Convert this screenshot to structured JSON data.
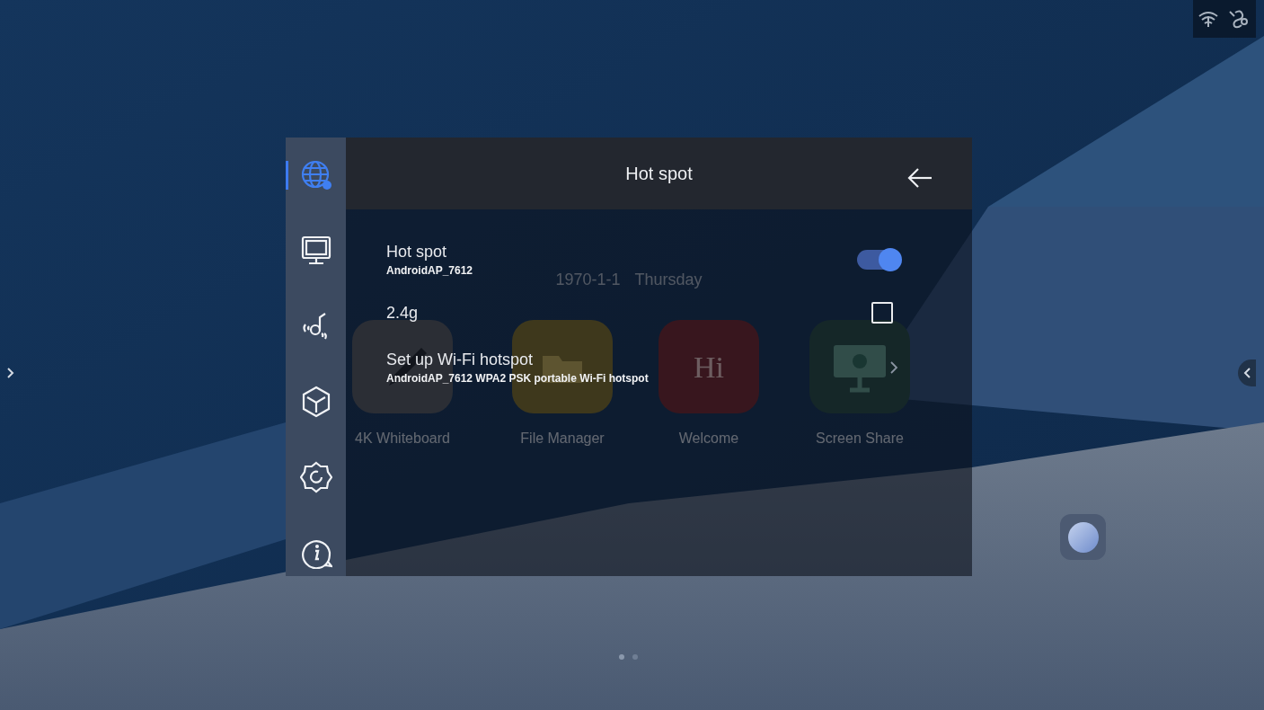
{
  "home": {
    "date": "1970-1-1",
    "weekday": "Thursday",
    "apps": [
      {
        "label": "4K Whiteboard",
        "kind": "pen"
      },
      {
        "label": "File Manager",
        "kind": "folder"
      },
      {
        "label": "Welcome",
        "kind": "greeting",
        "text": "Hi"
      },
      {
        "label": "Screen Share",
        "kind": "screen"
      }
    ]
  },
  "settings": {
    "title": "Hot spot",
    "sidebar": [
      {
        "kind": "network",
        "selected": true
      },
      {
        "kind": "display",
        "selected": false
      },
      {
        "kind": "audio",
        "selected": false
      },
      {
        "kind": "apps",
        "selected": false
      },
      {
        "kind": "system",
        "selected": false
      },
      {
        "kind": "about",
        "selected": false
      }
    ],
    "rows": [
      {
        "kind": "switch",
        "title": "Hot spot",
        "subtitle": "AndroidAP_7612",
        "on": true
      },
      {
        "kind": "checkbox",
        "title": "2.4g",
        "checked": false
      },
      {
        "kind": "link",
        "title": "Set up Wi-Fi hotspot",
        "subtitle": "AndroidAP_7612 WPA2 PSK portable Wi-Fi hotspot"
      }
    ]
  }
}
